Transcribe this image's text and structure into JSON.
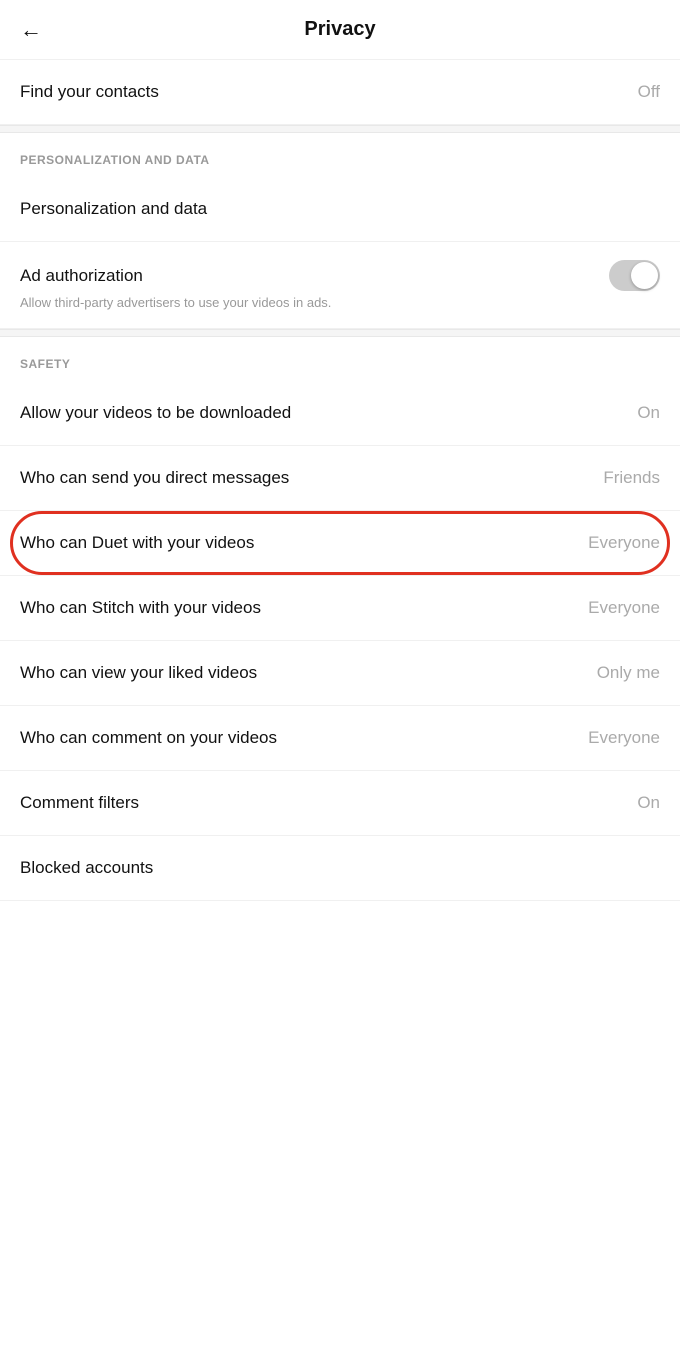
{
  "header": {
    "back_icon": "←",
    "title": "Privacy"
  },
  "top_section": {
    "find_contacts": {
      "label": "Find your contacts",
      "value": "Off"
    }
  },
  "personalization_section": {
    "section_label": "PERSONALIZATION AND DATA",
    "personalization_item": {
      "label": "Personalization and data"
    },
    "ad_authorization": {
      "label": "Ad authorization",
      "subtitle": "Allow third-party advertisers to use your videos in ads.",
      "toggle_on": false
    }
  },
  "safety_section": {
    "section_label": "SAFETY",
    "items": [
      {
        "label": "Allow your videos to be downloaded",
        "value": "On"
      },
      {
        "label": "Who can send you direct messages",
        "value": "Friends"
      },
      {
        "label": "Who can Duet with your videos",
        "value": "Everyone",
        "highlighted": true
      },
      {
        "label": "Who can Stitch with your videos",
        "value": "Everyone"
      },
      {
        "label": "Who can view your liked videos",
        "value": "Only me"
      },
      {
        "label": "Who can comment on your videos",
        "value": "Everyone"
      },
      {
        "label": "Comment filters",
        "value": "On"
      },
      {
        "label": "Blocked accounts",
        "value": ""
      }
    ]
  }
}
